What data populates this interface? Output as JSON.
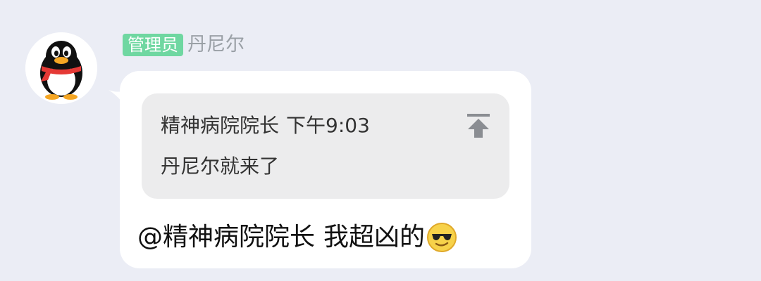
{
  "sender": {
    "role_badge": "管理员",
    "name": "丹尼尔",
    "avatar_icon": "qq-penguin-icon"
  },
  "quote": {
    "author": "精神病院院长",
    "time": "下午9:03",
    "text": "丹尼尔就来了",
    "jump_icon": "scroll-to-top-icon"
  },
  "message": {
    "mention": "@精神病院院长",
    "text": "我超凶的",
    "emoji_icon": "cool-sunglasses-emoji-icon"
  },
  "colors": {
    "background": "#ebedf5",
    "badge": "#6fd7a1",
    "bubble": "#ffffff",
    "quote_card": "#ececed",
    "muted_text": "#9aa0a6"
  }
}
